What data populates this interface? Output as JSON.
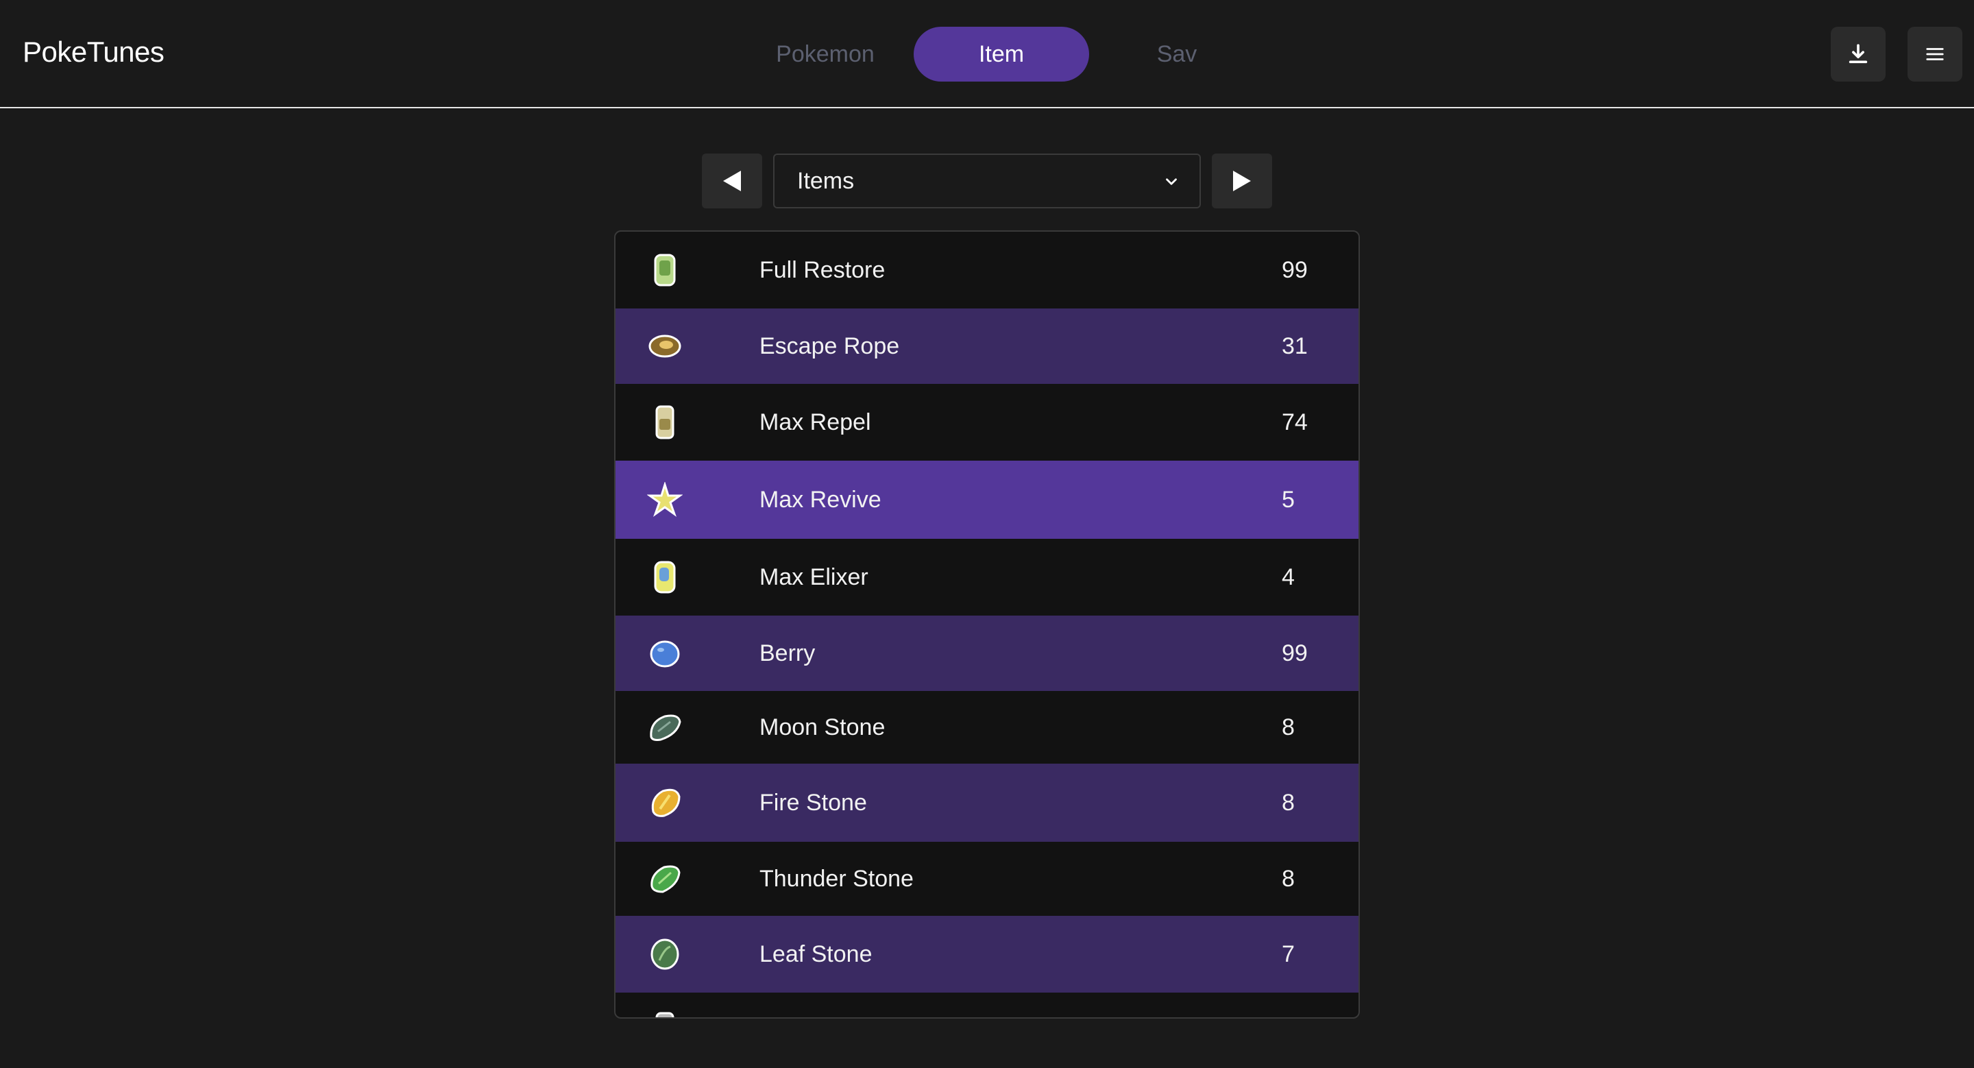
{
  "app": {
    "title": "PokeTunes"
  },
  "tabs": [
    {
      "label": "Pokemon",
      "active": false
    },
    {
      "label": "Item",
      "active": true
    },
    {
      "label": "Sav",
      "active": false
    }
  ],
  "toolbar": {
    "download_icon": "download-icon",
    "menu_icon": "hamburger-menu-icon"
  },
  "selector": {
    "value": "Items",
    "prev_icon": "triangle-left-icon",
    "next_icon": "triangle-right-icon"
  },
  "colors": {
    "accent": "#54379a",
    "row_alt": "#3a2a62",
    "background": "#1a1a1a"
  },
  "items": [
    {
      "name": "Full Restore",
      "qty": "99",
      "icon": "full-restore-icon"
    },
    {
      "name": "Escape Rope",
      "qty": "31",
      "icon": "escape-rope-icon"
    },
    {
      "name": "Max Repel",
      "qty": "74",
      "icon": "max-repel-icon"
    },
    {
      "name": "Max Revive",
      "qty": "5",
      "icon": "max-revive-icon"
    },
    {
      "name": "Max Elixer",
      "qty": "4",
      "icon": "max-elixer-icon"
    },
    {
      "name": "Berry",
      "qty": "99",
      "icon": "berry-icon"
    },
    {
      "name": "Moon Stone",
      "qty": "8",
      "icon": "moon-stone-icon"
    },
    {
      "name": "Fire Stone",
      "qty": "8",
      "icon": "fire-stone-icon"
    },
    {
      "name": "Thunder Stone",
      "qty": "8",
      "icon": "thunder-stone-icon"
    },
    {
      "name": "Leaf Stone",
      "qty": "7",
      "icon": "leaf-stone-icon"
    }
  ]
}
